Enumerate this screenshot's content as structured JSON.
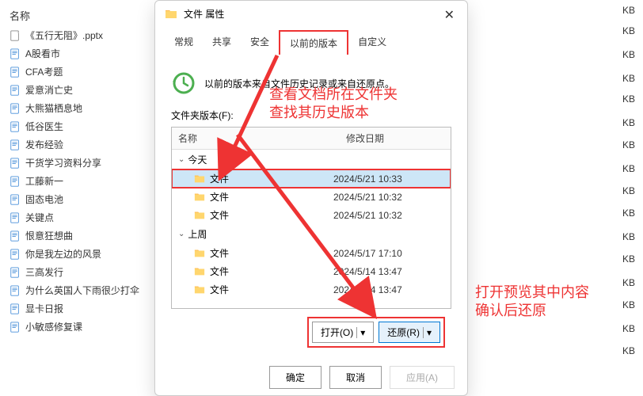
{
  "bg": {
    "header": "名称",
    "items": [
      {
        "icon": "pptx",
        "name": "《五行无阻》.pptx"
      },
      {
        "icon": "doc",
        "name": "A股看市"
      },
      {
        "icon": "doc",
        "name": "CFA考题"
      },
      {
        "icon": "doc",
        "name": "爱意消亡史"
      },
      {
        "icon": "doc",
        "name": "大熊猫栖息地"
      },
      {
        "icon": "doc",
        "name": "低谷医生"
      },
      {
        "icon": "doc",
        "name": "发布经验"
      },
      {
        "icon": "doc",
        "name": "干货学习资料分享"
      },
      {
        "icon": "doc",
        "name": "工藤新一"
      },
      {
        "icon": "doc",
        "name": "固态电池"
      },
      {
        "icon": "doc",
        "name": "关键点"
      },
      {
        "icon": "doc",
        "name": "恨意狂想曲"
      },
      {
        "icon": "doc",
        "name": "你是我左边的风景"
      },
      {
        "icon": "doc",
        "name": "三高发行"
      },
      {
        "icon": "doc",
        "name": "为什么英国人下雨很少打伞"
      },
      {
        "icon": "doc",
        "name": "显卡日报"
      },
      {
        "icon": "doc",
        "name": "小敏感修复课"
      }
    ],
    "kb_label": "KB"
  },
  "dialog": {
    "title": "文件 属性",
    "tabs": [
      "常规",
      "共享",
      "安全",
      "以前的版本",
      "自定义"
    ],
    "active_tab": 3,
    "info_text": "以前的版本来自文件历史记录或来自还原点。",
    "section_label": "文件夹版本(F):",
    "cols": {
      "name": "名称",
      "date": "修改日期"
    },
    "groups": [
      {
        "label": "今天",
        "items": [
          {
            "name": "文件",
            "date": "2024/5/21 10:33",
            "selected": true
          },
          {
            "name": "文件",
            "date": "2024/5/21 10:32"
          },
          {
            "name": "文件",
            "date": "2024/5/21 10:32"
          }
        ]
      },
      {
        "label": "上周",
        "items": [
          {
            "name": "文件",
            "date": "2024/5/17 17:10"
          },
          {
            "name": "文件",
            "date": "2024/5/14 13:47"
          },
          {
            "name": "文件",
            "date": "2024/5/14 13:47"
          }
        ]
      }
    ],
    "open_btn": "打开(O)",
    "restore_btn": "还原(R)",
    "ok": "确定",
    "cancel": "取消",
    "apply": "应用(A)"
  },
  "annotations": {
    "a1_l1": "查看文档所在文件夹",
    "a1_l2": "查找其历史版本",
    "a2_l1": "打开预览其中内容",
    "a2_l2": "确认后还原"
  }
}
